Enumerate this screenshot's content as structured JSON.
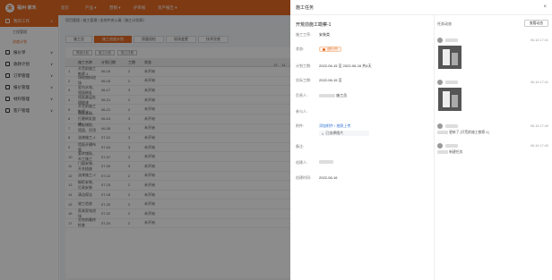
{
  "app": {
    "name": "福州·家禾",
    "logo_char": "禾",
    "nav": [
      "首页",
      "产品 ▾",
      "营销 ▾",
      "护审核",
      "资产报告 ▾"
    ]
  },
  "sidebar": {
    "items": [
      {
        "label": "我的工作",
        "active": true
      },
      {
        "label": "工程管理"
      },
      {
        "label": "进度计划",
        "active_sub": true
      },
      {
        "label": "报价单"
      },
      {
        "label": "收款计划"
      },
      {
        "label": "订单管理"
      },
      {
        "label": "报价管理"
      },
      {
        "label": "材料管理"
      },
      {
        "label": "客户管理"
      }
    ]
  },
  "main": {
    "breadcrumb": "项目管理 / 施工管理 / 金地中央公寓（施工计划表）",
    "tabs": [
      "施工总",
      "施工进度计划",
      "质量巡检",
      "现场变更",
      "技术交底"
    ],
    "filters": [
      "筛选计划",
      "施工计划",
      "施工日期"
    ],
    "columns": [
      "",
      "施工名称",
      "计划日期",
      "工期",
      "状态"
    ],
    "gantt_month": "2022-06",
    "gantt_days": [
      "13",
      "14",
      "15",
      "16",
      "17",
      "18",
      "19"
    ],
    "rows": [
      [
        "1",
        "开荒前施工勘察-1",
        "06-15",
        "2",
        "未开始"
      ],
      [
        "2",
        "场地物料进场",
        "06-16",
        "2",
        "未开始"
      ],
      [
        "3",
        "室内水电、墙面刷乳",
        "06-17",
        "3",
        "未开始"
      ],
      [
        "4",
        "墙面基层处理刷漆",
        "06-21",
        "2",
        "未开始"
      ],
      [
        "5",
        "开荒前施工勘察-2",
        "06-21",
        "2",
        "未开始"
      ],
      [
        "6",
        "墙面基础、打磨刷乳胶漆",
        "06-24",
        "3",
        "未开始"
      ],
      [
        "7",
        "地板铺贴、墙面、吊顶",
        "06-28",
        "3",
        "未开始"
      ],
      [
        "8",
        "油漆施工-1",
        "07-01",
        "3",
        "未开始"
      ],
      [
        "9",
        "墙面开槽布管",
        "07-04",
        "3",
        "未开始"
      ],
      [
        "10",
        "瓷砖铺贴、木工施工",
        "07-07",
        "3",
        "未开始"
      ],
      [
        "11",
        "门窗安装、开关插座",
        "07-09",
        "3",
        "未开始"
      ],
      [
        "12",
        "油漆施工-2",
        "07-12",
        "2",
        "未开始"
      ],
      [
        "13",
        "橱柜安装、灯具安装",
        "07-15",
        "2",
        "未开始"
      ],
      [
        "14",
        "清洁保洁",
        "07-18",
        "2",
        "未开始"
      ],
      [
        "15",
        "竣工验收",
        "07-20",
        "2",
        "未开始"
      ],
      [
        "16",
        "家具家电进场",
        "07-22",
        "2",
        "未开始"
      ],
      [
        "17",
        "交房前最终检查",
        "07-24",
        "2",
        "未开始"
      ]
    ]
  },
  "drawer": {
    "title": "施工任务",
    "close_icon": "×",
    "task_title": "开荒前施工勘察-1",
    "fields": {
      "project_label": "施工工序:",
      "project_value": "安装类",
      "status_label": "状态:",
      "status_value": "进行中",
      "plan_label": "计划工期:",
      "plan_value": "2022-06-15 至 2022-06-16 共4天",
      "actual_label": "实际工期:",
      "actual_value": "2022-06-15 至",
      "owner_label": "负责人:",
      "owner_suffix": "施工员",
      "participants_label": "参与人:",
      "attachment_label": "附件:",
      "attachment_link": "添加附件 / 拍照上传",
      "attachment_file": "已选择图片",
      "remark_label": "备注:",
      "creator_label": "创建人:",
      "created_label": "创建时间:",
      "created_value": "2022-06-16"
    },
    "activity": {
      "title": "任务动态",
      "button": "查看动态",
      "entries": [
        {
          "time": "06-16 17:41",
          "has_photo": true,
          "msg": ""
        },
        {
          "time": "06-16 17:41",
          "has_photo": true,
          "msg": ""
        },
        {
          "time": "06-16 17:40",
          "has_photo": false,
          "msg": "更新了 [开荒前施工勘察-1]"
        },
        {
          "time": "06-16 17:40",
          "has_photo": false,
          "msg": "新建任务"
        }
      ]
    }
  },
  "colors": {
    "accent": "#e36a23",
    "link": "#2d6fd6"
  }
}
